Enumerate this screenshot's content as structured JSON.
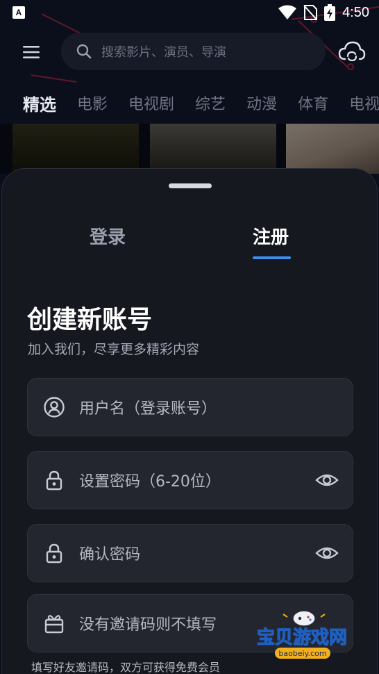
{
  "status_bar": {
    "notification_icon_letter": "A",
    "time": "4:50"
  },
  "header": {
    "search_placeholder": "搜索影片、演员、导演",
    "categories": [
      "精选",
      "电影",
      "电视剧",
      "综艺",
      "动漫",
      "体育",
      "电视"
    ],
    "active_category": "精选"
  },
  "sheet": {
    "tabs": {
      "login": "登录",
      "register": "注册",
      "active": "注册"
    },
    "title": "创建新账号",
    "subtitle": "加入我们，尽享更多精彩内容",
    "fields": {
      "username_placeholder": "用户名（登录账号）",
      "password_placeholder": "设置密码（6-20位）",
      "confirm_placeholder": "确认密码",
      "invite_placeholder": "没有邀请码则不填写"
    },
    "invite_hint": "填写好友邀请码，双方可获得免费会员"
  },
  "watermark": {
    "name": "宝贝游戏网",
    "domain": "baobeiy.com"
  },
  "colors": {
    "background": "#0b0f1c",
    "sheet": "#15181f",
    "field": "#23262e",
    "accent": "#3b8ff0",
    "decoration": "#7a1f33"
  },
  "icons": [
    "menu-icon",
    "search-icon",
    "cloud-sync-icon",
    "user-icon",
    "lock-icon",
    "eye-icon",
    "gift-icon",
    "wifi-icon",
    "sim-icon",
    "battery-icon"
  ]
}
